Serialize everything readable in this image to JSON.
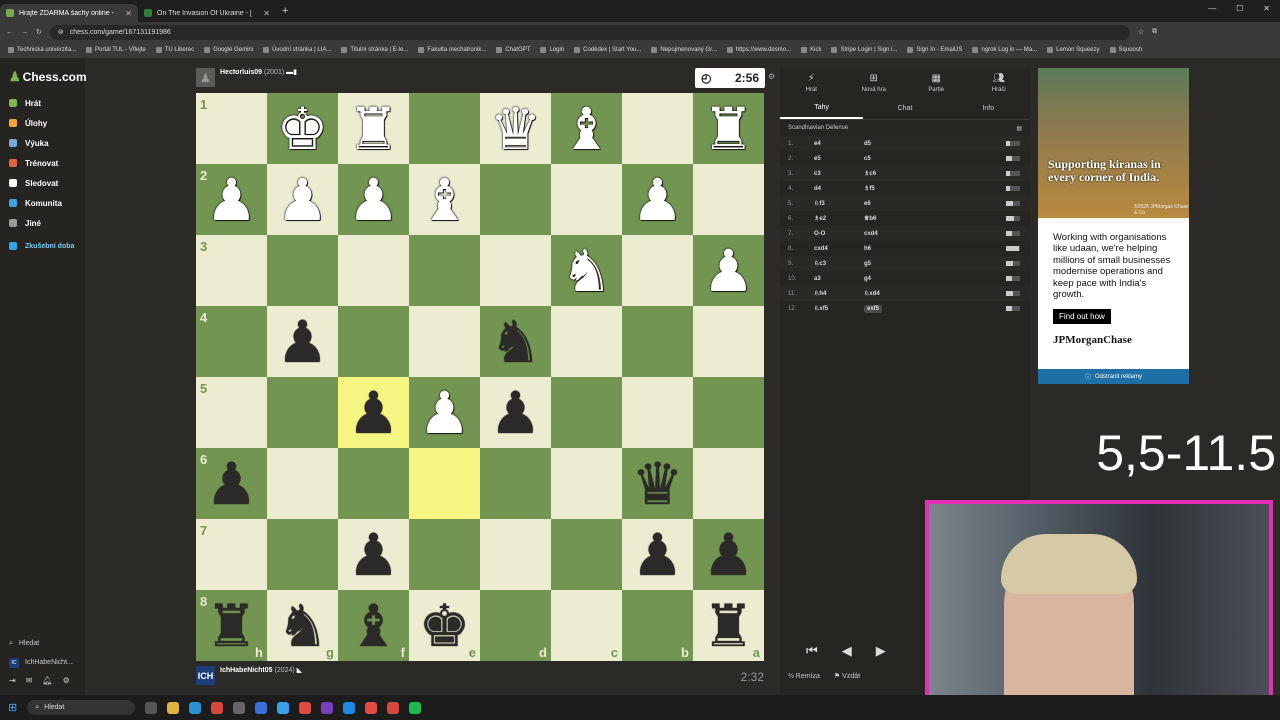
{
  "browser": {
    "tabs": [
      {
        "title": "Hrajte ZDARMA šachy online -",
        "active": true
      },
      {
        "title": "On The Invasion Of Ukraine - [",
        "active": false
      }
    ],
    "url": "chess.com/game/167131191986",
    "bookmarks": [
      "Technická univerzita...",
      "Portál TUL - Vřlejte",
      "TU Liberec",
      "Google Gemini",
      "Úvodní stránka | LIA...",
      "Titulní stránka | E-le...",
      "Fakulta mechatronik...",
      "ChatGPT",
      "Login",
      "Codédex | Start You...",
      "Nepojmenovaný Gr...",
      "https://www.desmo...",
      "Kick",
      "Stripe Login | Sign i...",
      "Sign In - EmailJS",
      "ngrok Log in — Ma...",
      "Lemon Squeezy",
      "Squoosh"
    ]
  },
  "sidebar": {
    "logo": "Chess.com",
    "items": [
      {
        "label": "Hrát",
        "color": "#81b64c"
      },
      {
        "label": "Úlohy",
        "color": "#f2a640"
      },
      {
        "label": "Výuka",
        "color": "#7aa5d6"
      },
      {
        "label": "Trénovat",
        "color": "#e0653d"
      },
      {
        "label": "Sledovat",
        "color": "#ffffff"
      },
      {
        "label": "Komunita",
        "color": "#3ea1dd"
      },
      {
        "label": "Jiné",
        "color": "#999999"
      },
      {
        "label": "Zkušební doba",
        "color": "#35a1e8"
      }
    ],
    "search": "Hledat",
    "user": "IchHabeNicht..."
  },
  "game": {
    "top_player": {
      "name": "Hectorluis09",
      "rating": "(2001)",
      "clock": "2:56"
    },
    "bottom_player": {
      "name": "IchHabeNicht05",
      "rating": "(2024)",
      "clock": "2:32"
    },
    "ranks": [
      "1",
      "2",
      "3",
      "4",
      "5",
      "6",
      "7",
      "8"
    ],
    "files": [
      "h",
      "g",
      "f",
      "e",
      "d",
      "c",
      "b",
      "a"
    ],
    "board": [
      [
        "",
        "wK",
        "wR",
        "",
        "wQ",
        "wB",
        "",
        "wR"
      ],
      [
        "wP",
        "wP",
        "wP",
        "wB",
        "",
        "",
        "wP",
        ""
      ],
      [
        "",
        "",
        "",
        "",
        "",
        "wN",
        "",
        "wP"
      ],
      [
        "",
        "bP",
        "",
        "",
        "bN",
        "",
        "",
        ""
      ],
      [
        "",
        "",
        "bP",
        "wP",
        "bP",
        "",
        "",
        ""
      ],
      [
        "bP",
        "",
        "",
        "",
        "",
        "",
        "bQ",
        ""
      ],
      [
        "",
        "",
        "bP",
        "",
        "",
        "",
        "bP",
        "bP"
      ],
      [
        "bR",
        "bN",
        "bB",
        "bK",
        "",
        "",
        "",
        "bR"
      ]
    ],
    "highlights": [
      [
        4,
        2
      ],
      [
        5,
        3
      ]
    ]
  },
  "panel": {
    "tabs": [
      "Hrát",
      "Nová hra",
      "Partie",
      "Hráči"
    ],
    "subtabs": [
      "Tahy",
      "Chat",
      "Info"
    ],
    "opening": "Scandinavian Defense",
    "moves": [
      {
        "n": "1.",
        "w": "e4",
        "b": "d5",
        "bar": 0.3
      },
      {
        "n": "2.",
        "w": "e5",
        "b": "c5",
        "bar": 0.4
      },
      {
        "n": "3.",
        "w": "c3",
        "b": "♗c6",
        "bar": 0.3
      },
      {
        "n": "4.",
        "w": "d4",
        "b": "♗f5",
        "bar": 0.3
      },
      {
        "n": "5.",
        "w": "♘f3",
        "b": "e6",
        "bar": 0.5
      },
      {
        "n": "6.",
        "w": "♗e2",
        "b": "♕b6",
        "bar": 0.6
      },
      {
        "n": "7.",
        "w": "O-O",
        "b": "cxd4",
        "bar": 0.4
      },
      {
        "n": "8.",
        "w": "cxd4",
        "b": "h6",
        "bar": 0.9
      },
      {
        "n": "9.",
        "w": "♘c3",
        "b": "g5",
        "bar": 0.5
      },
      {
        "n": "10.",
        "w": "a3",
        "b": "g4",
        "bar": 0.4
      },
      {
        "n": "11.",
        "w": "♘h4",
        "b": "♘xd4",
        "bar": 0.5
      },
      {
        "n": "12.",
        "w": "♘xf5",
        "b": "exf5",
        "bar": 0.4
      }
    ],
    "footer": [
      "Remíza",
      "Vzdát"
    ]
  },
  "ad": {
    "headline": "Supporting kiranas in every corner of India.",
    "copyright": "©2025 JPMorgan Chase & Co.",
    "body": "Working with organisations like udaan, we're helping millions of small businesses modernise operations and keep pace with India's growth.",
    "cta": "Find out how",
    "brand": "JPMorganChase",
    "remove": "Odstranit reklamy"
  },
  "overlay": {
    "score": "5,5-11.5"
  },
  "taskbar": {
    "search": "Hledat"
  }
}
